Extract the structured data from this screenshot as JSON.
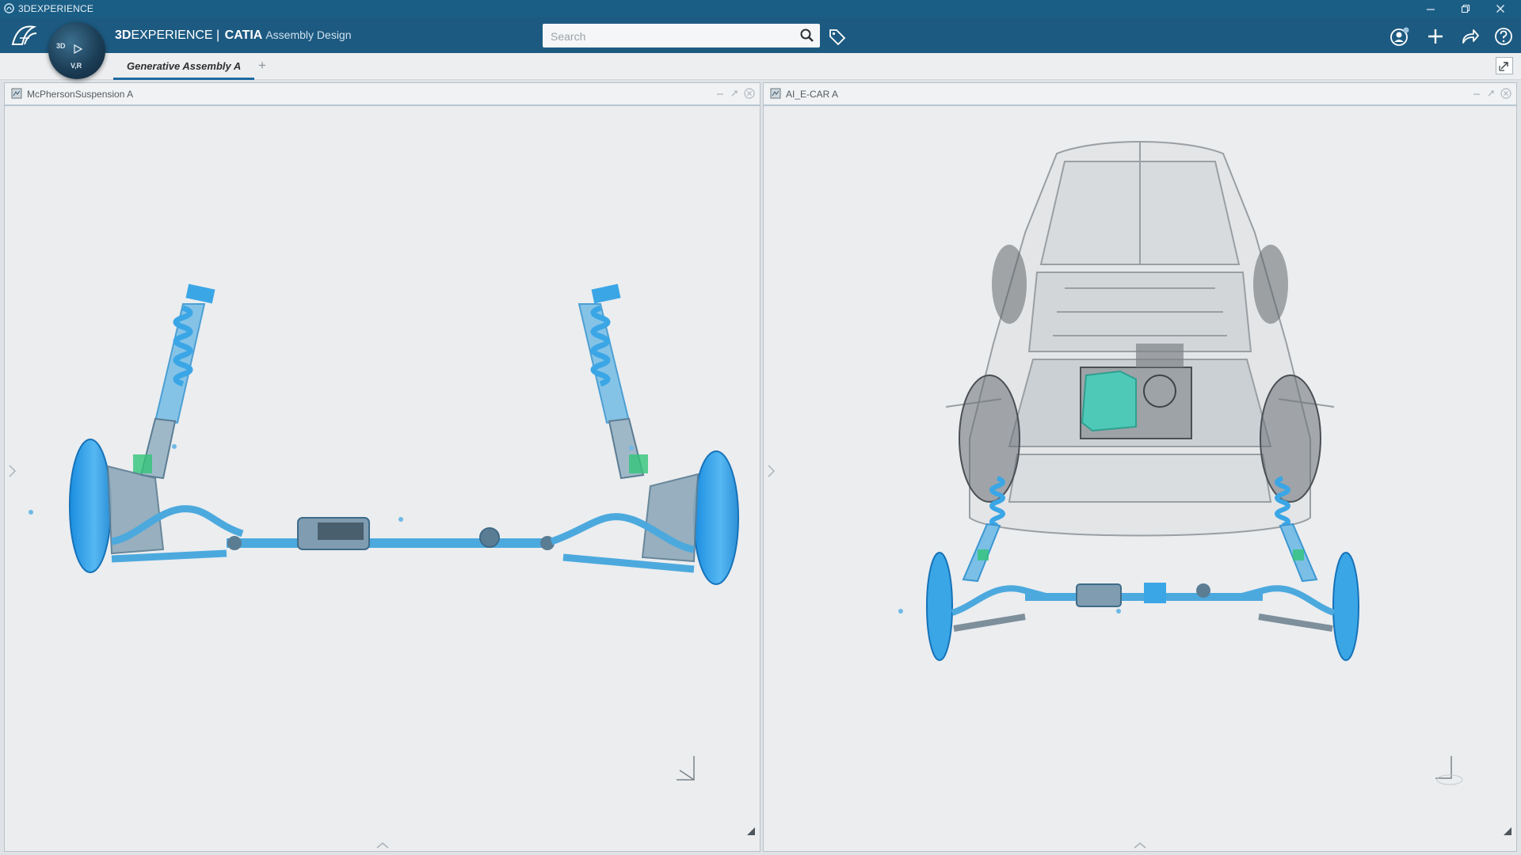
{
  "os_window": {
    "title": "3DEXPERIENCE"
  },
  "app_bar": {
    "brand_bold": "3D",
    "brand_light": "EXPERIENCE",
    "separator": " | ",
    "app_name": "CATIA",
    "app_role": "Assembly Design",
    "search": {
      "placeholder": "Search",
      "value": ""
    }
  },
  "compass": {
    "label_top": "3D",
    "label_bottom": "V,R"
  },
  "tabs": [
    {
      "label": "Generative Assembly A",
      "active": true
    }
  ],
  "tab_add_label": "+",
  "panes": [
    {
      "title": "McPhersonSuspension A"
    },
    {
      "title": "AI_E-CAR A"
    }
  ],
  "colors": {
    "os_bar": "#1b5e85",
    "app_bar": "#1d5a81",
    "tab_underline": "#1e6aa0",
    "suspension_blue": "#3aa6e6",
    "highlight_green": "#33c47a",
    "battery_teal": "#4ec9b8",
    "viewport_bg": "#ebedef"
  }
}
